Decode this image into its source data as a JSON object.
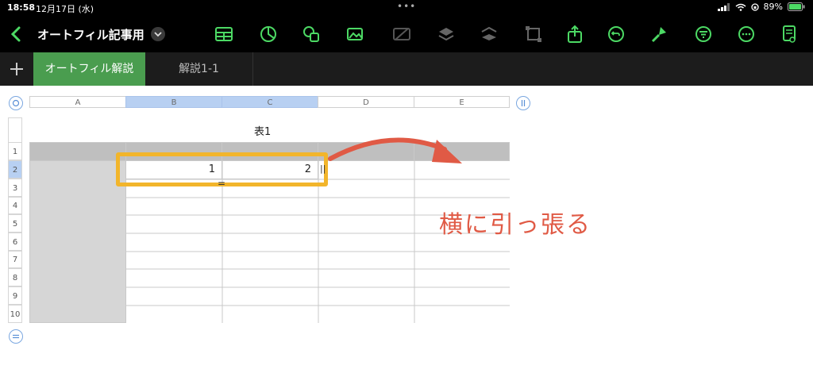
{
  "status": {
    "time": "18:58",
    "date": "12月17日 (水)",
    "battery": "89%"
  },
  "toolbar": {
    "title": "オートフィル記事用",
    "icons": [
      "table-icon",
      "chart-icon",
      "shapes-icon",
      "media-icon",
      "disabled-media-icon",
      "layers-forward-icon",
      "layers-back-icon",
      "selection-icon",
      "share-icon",
      "undo-icon",
      "format-brush-icon",
      "filter-icon",
      "more-icon",
      "document-view-icon"
    ]
  },
  "tabs": [
    {
      "label": "オートフィル解説",
      "active": true
    },
    {
      "label": "解説1-1",
      "active": false
    }
  ],
  "columns": [
    "A",
    "B",
    "C",
    "D",
    "E"
  ],
  "rows": [
    "1",
    "2",
    "3",
    "4",
    "5",
    "6",
    "7",
    "8",
    "9",
    "10"
  ],
  "table": {
    "title": "表1",
    "b2": "1",
    "c2": "2"
  },
  "handles": {
    "right": "||",
    "bottom": "="
  },
  "annotation": "横に引っ張る",
  "colors": {
    "accent": "#4a9d4f",
    "selection": "#f2b52b",
    "annotation": "#e05a45",
    "header_blue": "#b8d0f2"
  }
}
